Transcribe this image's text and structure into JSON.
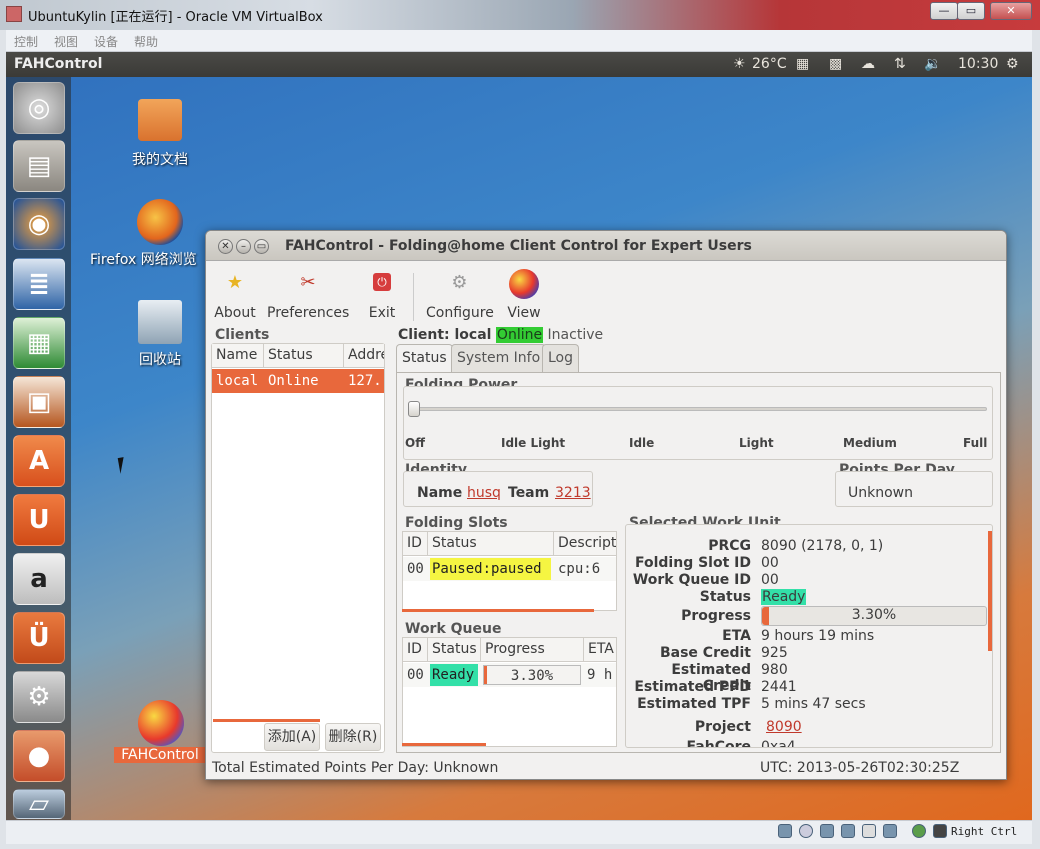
{
  "host": {
    "title": "UbuntuKylin [正在运行] - Oracle VM VirtualBox",
    "menu": [
      "控制",
      "视图",
      "设备",
      "帮助"
    ],
    "host_key": "Right Ctrl"
  },
  "panel": {
    "title": "FAHControl",
    "weather": "26°C",
    "time": "10:30"
  },
  "launcher": {
    "items": [
      "dash-home",
      "files",
      "firefox",
      "writer",
      "calc",
      "impress",
      "software-center",
      "ubuntu-one",
      "amazon",
      "ubuntu-one-music",
      "system-settings",
      "fahcontrol",
      "workspaces"
    ]
  },
  "desktop": {
    "icons": [
      {
        "label": "我的文档"
      },
      {
        "label": "Firefox 网络浏览"
      },
      {
        "label": "回收站"
      },
      {
        "label": "FAHControl"
      }
    ]
  },
  "window": {
    "title": "FAHControl - Folding@home Client Control for Expert Users",
    "toolbar": {
      "about": "About",
      "preferences": "Preferences",
      "exit": "Exit",
      "configure": "Configure",
      "view": "View"
    },
    "clients": {
      "heading": "Clients",
      "columns": [
        "Name",
        "Status",
        "Addre"
      ],
      "rows": [
        {
          "name": "local",
          "status": "Online",
          "address": "127."
        }
      ],
      "add_button": "添加(A)",
      "delete_button": "删除(R)"
    },
    "client_header": {
      "prefix": "Client: local",
      "online": "Online",
      "inactive": "Inactive"
    },
    "tabs": [
      "Status",
      "System Info",
      "Log"
    ],
    "folding_power": {
      "heading": "Folding Power",
      "levels": [
        "Off",
        "Idle Light",
        "Idle",
        "Light",
        "Medium",
        "Full"
      ],
      "value": "Off"
    },
    "identity": {
      "heading": "Identity",
      "name_label": "Name",
      "name": "husq",
      "team_label": "Team",
      "team": "3213"
    },
    "ppd": {
      "heading": "Points Per Day",
      "value": "Unknown"
    },
    "slots": {
      "heading": "Folding Slots",
      "columns": [
        "ID",
        "Status",
        "Descripti"
      ],
      "rows": [
        {
          "id": "00",
          "status": "Paused:paused",
          "description": "cpu:6"
        }
      ]
    },
    "queue": {
      "heading": "Work Queue",
      "columns": [
        "ID",
        "Status",
        "Progress",
        "ETA"
      ],
      "rows": [
        {
          "id": "00",
          "status": "Ready",
          "progress": "3.30%",
          "eta": "9 h"
        }
      ]
    },
    "work_unit": {
      "heading": "Selected Work Unit",
      "prcg_label": "PRCG",
      "prcg": "8090 (2178, 0, 1)",
      "slot_label": "Folding Slot ID",
      "slot": "00",
      "queue_label": "Work Queue ID",
      "queue": "00",
      "status_label": "Status",
      "status": "Ready",
      "progress_label": "Progress",
      "progress": "3.30%",
      "progress_fraction": 0.033,
      "eta_label": "ETA",
      "eta": "9 hours 19 mins",
      "base_credit_label": "Base Credit",
      "base_credit": "925",
      "est_credit_label": "Estimated Credit",
      "est_credit": "980",
      "est_ppd_label": "Estimated PPD",
      "est_ppd": "2441",
      "est_tpf_label": "Estimated TPF",
      "est_tpf": "5 mins 47 secs",
      "project_label": "Project",
      "project": "8090",
      "fahcore_label": "FahCore",
      "fahcore": "0xa4"
    },
    "statusbar": {
      "total": "Total Estimated Points Per Day: Unknown",
      "utc": "UTC: 2013-05-26T02:30:25Z"
    }
  },
  "colors": {
    "online_green": "#33cc33",
    "ready_teal": "#33e0a8",
    "paused_yellow": "#f5f542",
    "selection_orange": "#e8683c",
    "link_red": "#c0392b"
  }
}
